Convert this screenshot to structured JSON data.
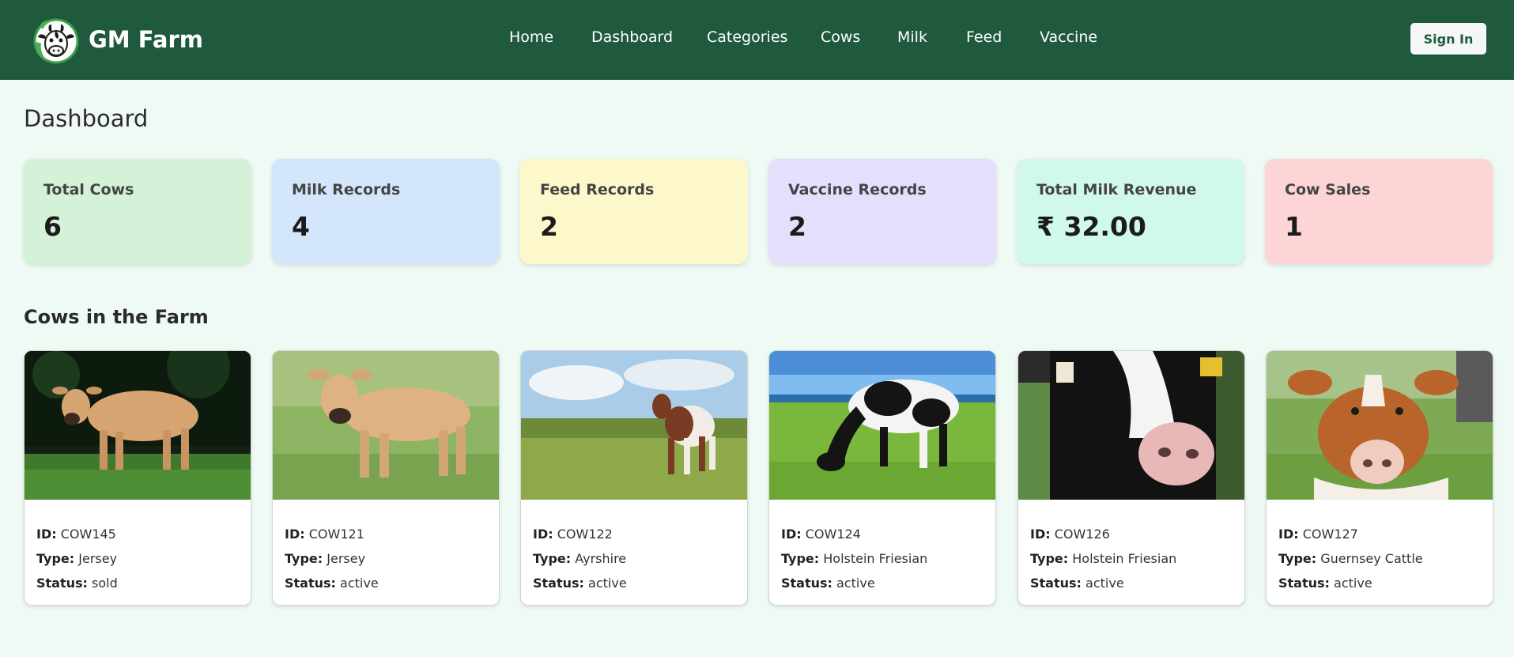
{
  "nav": {
    "brand": "GM Farm",
    "links": [
      "Home",
      "Dashboard",
      "Categories",
      "Cows",
      "Milk",
      "Feed",
      "Vaccine"
    ],
    "signin_label": "Sign In"
  },
  "page_title": "Dashboard",
  "stats": [
    {
      "label": "Total Cows",
      "value": "6",
      "color": "#d3f2d8"
    },
    {
      "label": "Milk Records",
      "value": "4",
      "color": "#d3e6fb"
    },
    {
      "label": "Feed Records",
      "value": "2",
      "color": "#fdf8cb"
    },
    {
      "label": "Vaccine Records",
      "value": "2",
      "color": "#e6defd"
    },
    {
      "label": "Total Milk Revenue",
      "value": "₹ 32.00",
      "color": "#d1f9ea"
    },
    {
      "label": "Cow Sales",
      "value": "1",
      "color": "#fdd5d6"
    }
  ],
  "section_title": "Cows in the Farm",
  "field_labels": {
    "id": "ID:",
    "type": "Type:",
    "status": "Status:"
  },
  "cows": [
    {
      "id": "COW145",
      "type": "Jersey",
      "status": "sold"
    },
    {
      "id": "COW121",
      "type": "Jersey",
      "status": "active"
    },
    {
      "id": "COW122",
      "type": "Ayrshire",
      "status": "active"
    },
    {
      "id": "COW124",
      "type": "Holstein Friesian",
      "status": "active"
    },
    {
      "id": "COW126",
      "type": "Holstein Friesian",
      "status": "active"
    },
    {
      "id": "COW127",
      "type": "Guernsey Cattle",
      "status": "active"
    }
  ]
}
